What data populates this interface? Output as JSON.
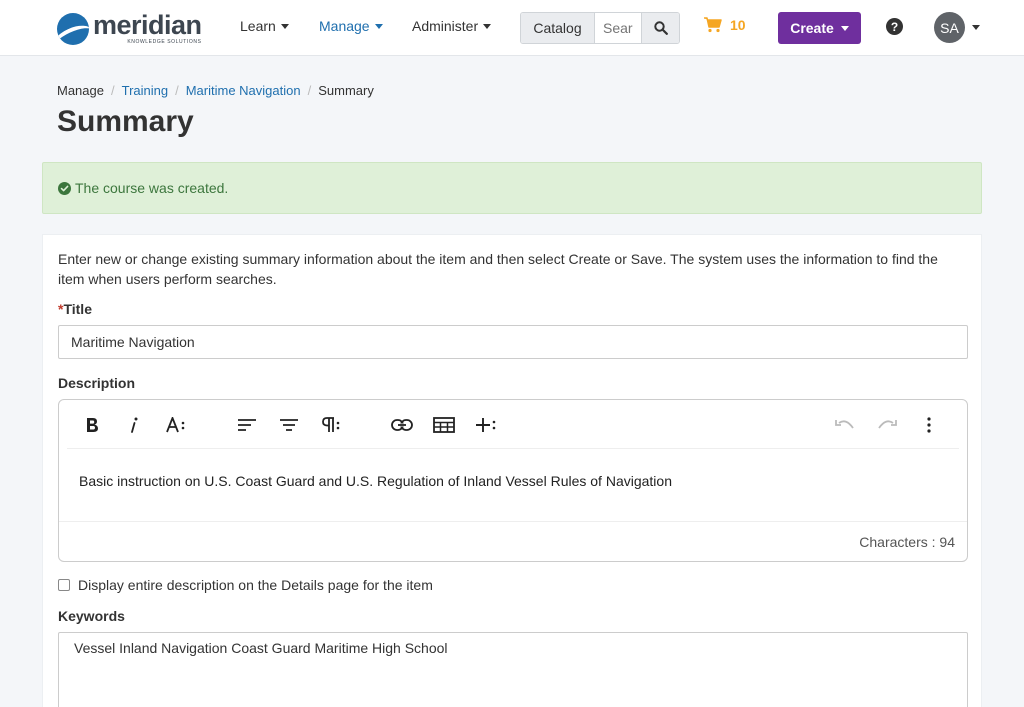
{
  "brand": {
    "name": "meridian",
    "tagline": "KNOWLEDGE SOLUTIONS"
  },
  "nav": {
    "learn": "Learn",
    "manage": "Manage",
    "administer": "Administer"
  },
  "search": {
    "catalog_label": "Catalog",
    "placeholder": "Search"
  },
  "cart": {
    "count": "10"
  },
  "create_label": "Create",
  "user": {
    "initials": "SA"
  },
  "breadcrumb": {
    "root": "Manage",
    "training": "Training",
    "course": "Maritime Navigation",
    "current": "Summary"
  },
  "page_title": "Summary",
  "alert": {
    "message": "The course was created."
  },
  "form": {
    "intro": "Enter new or change existing summary information about the item and then select Create or Save. The system uses the information to find the item when users perform searches.",
    "title_label": "Title",
    "title_value": "Maritime Navigation",
    "description_label": "Description",
    "description_value": "Basic instruction on U.S. Coast Guard and U.S. Regulation of Inland Vessel Rules of Navigation",
    "characters_label": "Characters : 94",
    "display_checkbox_label": "Display entire description on the Details page for the item",
    "display_checkbox_checked": false,
    "keywords_label": "Keywords",
    "keywords_value": "Vessel Inland Navigation Coast Guard Maritime High School"
  },
  "colors": {
    "accent": "#1f6fae",
    "create": "#6f2f9e",
    "cart": "#f5a623",
    "success_bg": "#dff0d8",
    "success_text": "#3c763d"
  }
}
